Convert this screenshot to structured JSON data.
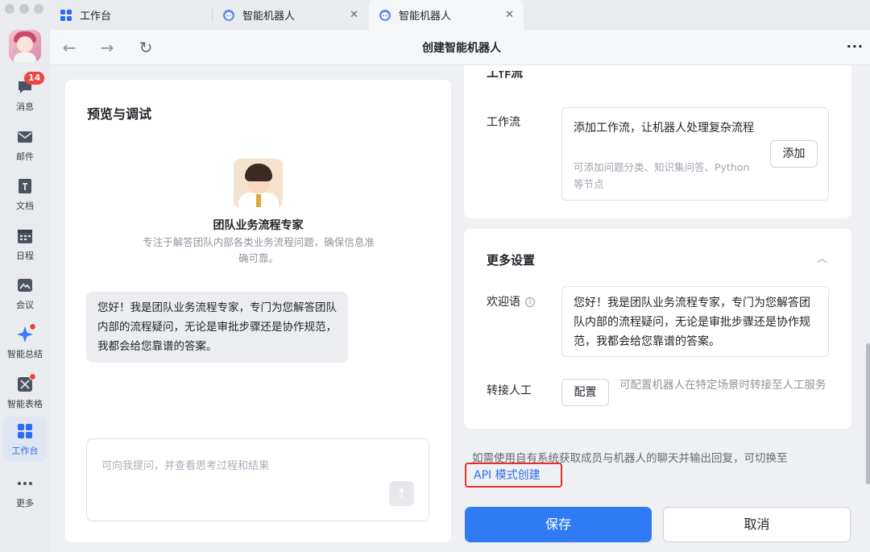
{
  "rail": {
    "messages_badge": "14",
    "items": [
      {
        "label": "消息"
      },
      {
        "label": "邮件"
      },
      {
        "label": "文档"
      },
      {
        "label": "日程"
      },
      {
        "label": "会议"
      },
      {
        "label": "智能总结"
      },
      {
        "label": "智能表格"
      },
      {
        "label": "工作台"
      },
      {
        "label": "更多"
      }
    ]
  },
  "tabs": [
    {
      "label": "工作台"
    },
    {
      "label": "智能机器人",
      "close": "✕"
    },
    {
      "label": "智能机器人",
      "close": "✕"
    }
  ],
  "navbar": {
    "back": "←",
    "forward": "→",
    "refresh": "↻",
    "title": "创建智能机器人",
    "more": "···"
  },
  "preview": {
    "title": "预览与调试",
    "bot_name": "团队业务流程专家",
    "bot_desc": "专注于解答团队内部各类业务流程问题，确保信息准确可靠。",
    "greeting": "您好！我是团队业务流程专家，专门为您解答团队内部的流程疑问，无论是审批步骤还是协作规范，我都会给您靠谱的答案。",
    "input_placeholder": "可向我提问，并查看思考过程和结果",
    "send": "↑"
  },
  "workflow": {
    "section_title": "工作流",
    "label": "工作流",
    "main_text": "添加工作流，让机器人处理复杂流程",
    "sub_text": "可添加问题分类、知识集问答、Python等节点",
    "add_button": "添加",
    "chevron": "︿"
  },
  "more_settings": {
    "title": "更多设置",
    "chevron": "︿",
    "welcome_label": "欢迎语",
    "welcome_text": "您好！我是团队业务流程专家，专门为您解答团队内部的流程疑问，无论是审批步骤还是协作规范，我都会给您靠谱的答案。",
    "transfer_label": "转接人工",
    "configure_button": "配置",
    "transfer_desc": "可配置机器人在特定场景时转接至人工服务"
  },
  "api": {
    "note": "如需使用自有系统获取成员与机器人的聊天并输出回复，可切换至",
    "link": "API 模式创建"
  },
  "actions": {
    "save": "保存",
    "cancel": "取消"
  },
  "colors": {
    "accent": "#2f7bf4",
    "link": "#2f6bf2",
    "highlight_border": "#e5322d",
    "badge": "#f04343"
  }
}
